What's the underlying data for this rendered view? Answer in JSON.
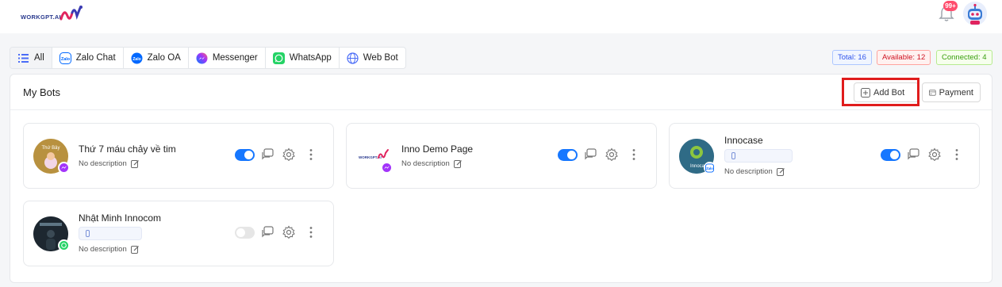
{
  "header": {
    "logo_text": "WORKGPT.AI",
    "notification_badge": "99+"
  },
  "tabs": [
    {
      "label": "All",
      "icon": "list-icon",
      "active": true
    },
    {
      "label": "Zalo Chat",
      "icon": "zalo-icon"
    },
    {
      "label": "Zalo OA",
      "icon": "zalo-oa-icon"
    },
    {
      "label": "Messenger",
      "icon": "messenger-icon"
    },
    {
      "label": "WhatsApp",
      "icon": "whatsapp-icon"
    },
    {
      "label": "Web Bot",
      "icon": "globe-icon"
    }
  ],
  "stats": {
    "total": "Total: 16",
    "available": "Available: 12",
    "connected": "Connected: 4"
  },
  "panel": {
    "title": "My Bots",
    "add_bot_label": "Add Bot",
    "payment_label": "Payment"
  },
  "bots": [
    {
      "name": "Thứ 7 máu chảy về tim",
      "avatar_text": "Thứ Bảy",
      "description": "No description",
      "channel": "messenger",
      "enabled": true
    },
    {
      "name": "Inno Demo Page",
      "description": "No description",
      "channel": "messenger",
      "enabled": true
    },
    {
      "name": "Innocase",
      "avatar_text": "Innoca",
      "description": "No description",
      "channel": "zalo",
      "enabled": true
    },
    {
      "name": "Nhật Minh Innocom",
      "description": "No description",
      "channel": "whatsapp",
      "enabled": false
    }
  ],
  "colors": {
    "accent": "#1677ff",
    "highlight": "#e01c1c",
    "messenger": "#a334fa",
    "whatsapp": "#25d366",
    "zalo": "#0068ff"
  }
}
